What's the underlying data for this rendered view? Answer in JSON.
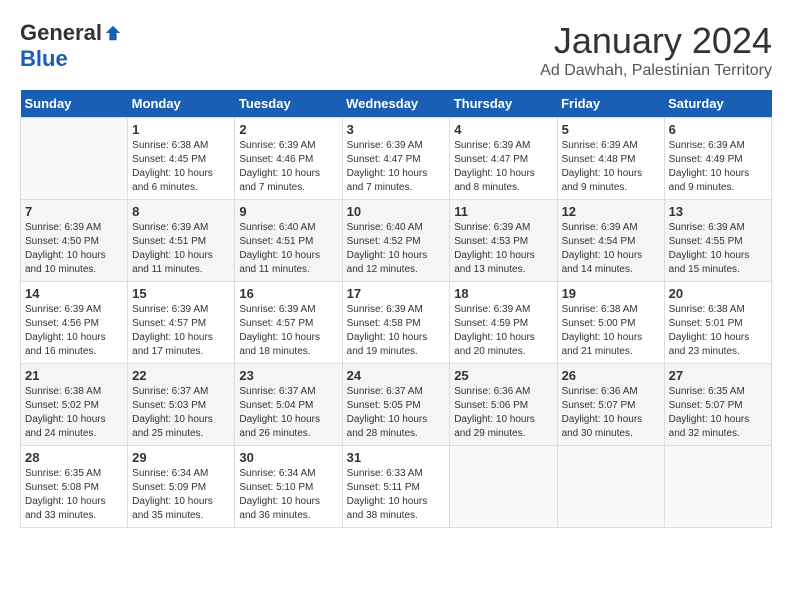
{
  "logo": {
    "general": "General",
    "blue": "Blue"
  },
  "title": "January 2024",
  "subtitle": "Ad Dawhah, Palestinian Territory",
  "days_header": [
    "Sunday",
    "Monday",
    "Tuesday",
    "Wednesday",
    "Thursday",
    "Friday",
    "Saturday"
  ],
  "weeks": [
    [
      {
        "num": "",
        "sunrise": "",
        "sunset": "",
        "daylight": ""
      },
      {
        "num": "1",
        "sunrise": "Sunrise: 6:38 AM",
        "sunset": "Sunset: 4:45 PM",
        "daylight": "Daylight: 10 hours and 6 minutes."
      },
      {
        "num": "2",
        "sunrise": "Sunrise: 6:39 AM",
        "sunset": "Sunset: 4:46 PM",
        "daylight": "Daylight: 10 hours and 7 minutes."
      },
      {
        "num": "3",
        "sunrise": "Sunrise: 6:39 AM",
        "sunset": "Sunset: 4:47 PM",
        "daylight": "Daylight: 10 hours and 7 minutes."
      },
      {
        "num": "4",
        "sunrise": "Sunrise: 6:39 AM",
        "sunset": "Sunset: 4:47 PM",
        "daylight": "Daylight: 10 hours and 8 minutes."
      },
      {
        "num": "5",
        "sunrise": "Sunrise: 6:39 AM",
        "sunset": "Sunset: 4:48 PM",
        "daylight": "Daylight: 10 hours and 9 minutes."
      },
      {
        "num": "6",
        "sunrise": "Sunrise: 6:39 AM",
        "sunset": "Sunset: 4:49 PM",
        "daylight": "Daylight: 10 hours and 9 minutes."
      }
    ],
    [
      {
        "num": "7",
        "sunrise": "Sunrise: 6:39 AM",
        "sunset": "Sunset: 4:50 PM",
        "daylight": "Daylight: 10 hours and 10 minutes."
      },
      {
        "num": "8",
        "sunrise": "Sunrise: 6:39 AM",
        "sunset": "Sunset: 4:51 PM",
        "daylight": "Daylight: 10 hours and 11 minutes."
      },
      {
        "num": "9",
        "sunrise": "Sunrise: 6:40 AM",
        "sunset": "Sunset: 4:51 PM",
        "daylight": "Daylight: 10 hours and 11 minutes."
      },
      {
        "num": "10",
        "sunrise": "Sunrise: 6:40 AM",
        "sunset": "Sunset: 4:52 PM",
        "daylight": "Daylight: 10 hours and 12 minutes."
      },
      {
        "num": "11",
        "sunrise": "Sunrise: 6:39 AM",
        "sunset": "Sunset: 4:53 PM",
        "daylight": "Daylight: 10 hours and 13 minutes."
      },
      {
        "num": "12",
        "sunrise": "Sunrise: 6:39 AM",
        "sunset": "Sunset: 4:54 PM",
        "daylight": "Daylight: 10 hours and 14 minutes."
      },
      {
        "num": "13",
        "sunrise": "Sunrise: 6:39 AM",
        "sunset": "Sunset: 4:55 PM",
        "daylight": "Daylight: 10 hours and 15 minutes."
      }
    ],
    [
      {
        "num": "14",
        "sunrise": "Sunrise: 6:39 AM",
        "sunset": "Sunset: 4:56 PM",
        "daylight": "Daylight: 10 hours and 16 minutes."
      },
      {
        "num": "15",
        "sunrise": "Sunrise: 6:39 AM",
        "sunset": "Sunset: 4:57 PM",
        "daylight": "Daylight: 10 hours and 17 minutes."
      },
      {
        "num": "16",
        "sunrise": "Sunrise: 6:39 AM",
        "sunset": "Sunset: 4:57 PM",
        "daylight": "Daylight: 10 hours and 18 minutes."
      },
      {
        "num": "17",
        "sunrise": "Sunrise: 6:39 AM",
        "sunset": "Sunset: 4:58 PM",
        "daylight": "Daylight: 10 hours and 19 minutes."
      },
      {
        "num": "18",
        "sunrise": "Sunrise: 6:39 AM",
        "sunset": "Sunset: 4:59 PM",
        "daylight": "Daylight: 10 hours and 20 minutes."
      },
      {
        "num": "19",
        "sunrise": "Sunrise: 6:38 AM",
        "sunset": "Sunset: 5:00 PM",
        "daylight": "Daylight: 10 hours and 21 minutes."
      },
      {
        "num": "20",
        "sunrise": "Sunrise: 6:38 AM",
        "sunset": "Sunset: 5:01 PM",
        "daylight": "Daylight: 10 hours and 23 minutes."
      }
    ],
    [
      {
        "num": "21",
        "sunrise": "Sunrise: 6:38 AM",
        "sunset": "Sunset: 5:02 PM",
        "daylight": "Daylight: 10 hours and 24 minutes."
      },
      {
        "num": "22",
        "sunrise": "Sunrise: 6:37 AM",
        "sunset": "Sunset: 5:03 PM",
        "daylight": "Daylight: 10 hours and 25 minutes."
      },
      {
        "num": "23",
        "sunrise": "Sunrise: 6:37 AM",
        "sunset": "Sunset: 5:04 PM",
        "daylight": "Daylight: 10 hours and 26 minutes."
      },
      {
        "num": "24",
        "sunrise": "Sunrise: 6:37 AM",
        "sunset": "Sunset: 5:05 PM",
        "daylight": "Daylight: 10 hours and 28 minutes."
      },
      {
        "num": "25",
        "sunrise": "Sunrise: 6:36 AM",
        "sunset": "Sunset: 5:06 PM",
        "daylight": "Daylight: 10 hours and 29 minutes."
      },
      {
        "num": "26",
        "sunrise": "Sunrise: 6:36 AM",
        "sunset": "Sunset: 5:07 PM",
        "daylight": "Daylight: 10 hours and 30 minutes."
      },
      {
        "num": "27",
        "sunrise": "Sunrise: 6:35 AM",
        "sunset": "Sunset: 5:07 PM",
        "daylight": "Daylight: 10 hours and 32 minutes."
      }
    ],
    [
      {
        "num": "28",
        "sunrise": "Sunrise: 6:35 AM",
        "sunset": "Sunset: 5:08 PM",
        "daylight": "Daylight: 10 hours and 33 minutes."
      },
      {
        "num": "29",
        "sunrise": "Sunrise: 6:34 AM",
        "sunset": "Sunset: 5:09 PM",
        "daylight": "Daylight: 10 hours and 35 minutes."
      },
      {
        "num": "30",
        "sunrise": "Sunrise: 6:34 AM",
        "sunset": "Sunset: 5:10 PM",
        "daylight": "Daylight: 10 hours and 36 minutes."
      },
      {
        "num": "31",
        "sunrise": "Sunrise: 6:33 AM",
        "sunset": "Sunset: 5:11 PM",
        "daylight": "Daylight: 10 hours and 38 minutes."
      },
      {
        "num": "",
        "sunrise": "",
        "sunset": "",
        "daylight": ""
      },
      {
        "num": "",
        "sunrise": "",
        "sunset": "",
        "daylight": ""
      },
      {
        "num": "",
        "sunrise": "",
        "sunset": "",
        "daylight": ""
      }
    ]
  ]
}
